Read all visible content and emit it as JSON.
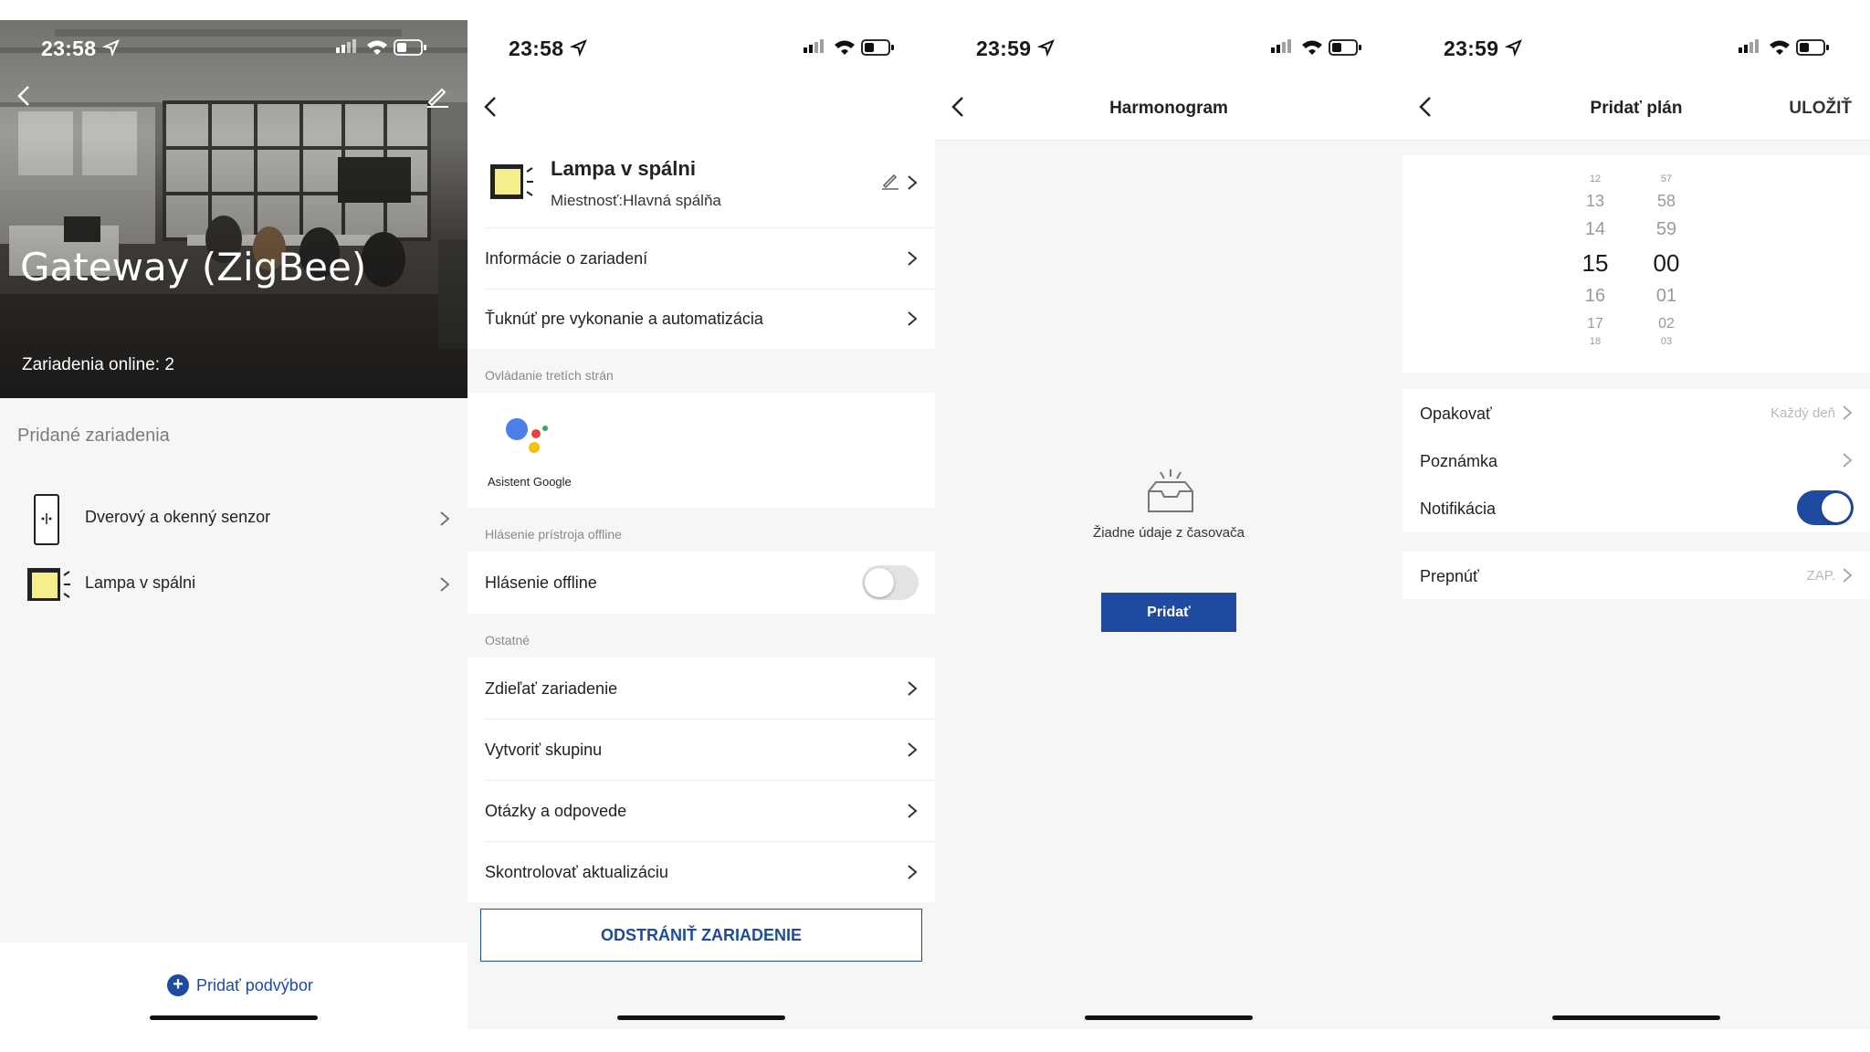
{
  "status_bars": [
    {
      "time": "23:58"
    },
    {
      "time": "23:58"
    },
    {
      "time": "23:59"
    },
    {
      "time": "23:59"
    }
  ],
  "screen1": {
    "title": "Gateway (ZigBee)",
    "online": "Zariadenia online: 2",
    "section": "Pridané zariadenia",
    "devices": [
      {
        "label": "Dverový a okenný senzor",
        "icon": "door-sensor-icon"
      },
      {
        "label": "Lampa v spálni",
        "icon": "lamp-icon"
      }
    ],
    "add_sub": "Pridať podvýbor"
  },
  "screen2": {
    "device_name": "Lampa v spálni",
    "room": "Miestnosť:Hlavná spálňa",
    "rows_top": [
      "Informácie o zariadení",
      "Ťuknúť pre vykonanie a automatizácia"
    ],
    "third_party_header": "Ovládanie tretích strán",
    "google_label": "Asistent Google",
    "offline_header": "Hlásenie prístroja offline",
    "offline_label": "Hlásenie offline",
    "offline_toggle_on": false,
    "other_header": "Ostatné",
    "rows_other": [
      "Zdieľať zariadenie",
      "Vytvoriť skupinu",
      "Otázky a odpovede",
      "Skontrolovať aktualizáciu"
    ],
    "remove": "ODSTRÁNIŤ ZARIADENIE"
  },
  "screen3": {
    "title": "Harmonogram",
    "empty": "Žiadne údaje z časovača",
    "add": "Pridať"
  },
  "screen4": {
    "title": "Pridať plán",
    "save": "ULOŽIŤ",
    "hours": [
      "12",
      "13",
      "14",
      "15",
      "16",
      "17",
      "18"
    ],
    "minutes": [
      "57",
      "58",
      "59",
      "00",
      "01",
      "02",
      "03"
    ],
    "repeat_label": "Opakovať",
    "repeat_value": "Každý deň",
    "note_label": "Poznámka",
    "notif_label": "Notifikácia",
    "notif_on": true,
    "switch_label": "Prepnúť",
    "switch_value": "ZAP."
  },
  "colors": {
    "accent": "#1e4ba0",
    "background": "#f6f6f6"
  }
}
